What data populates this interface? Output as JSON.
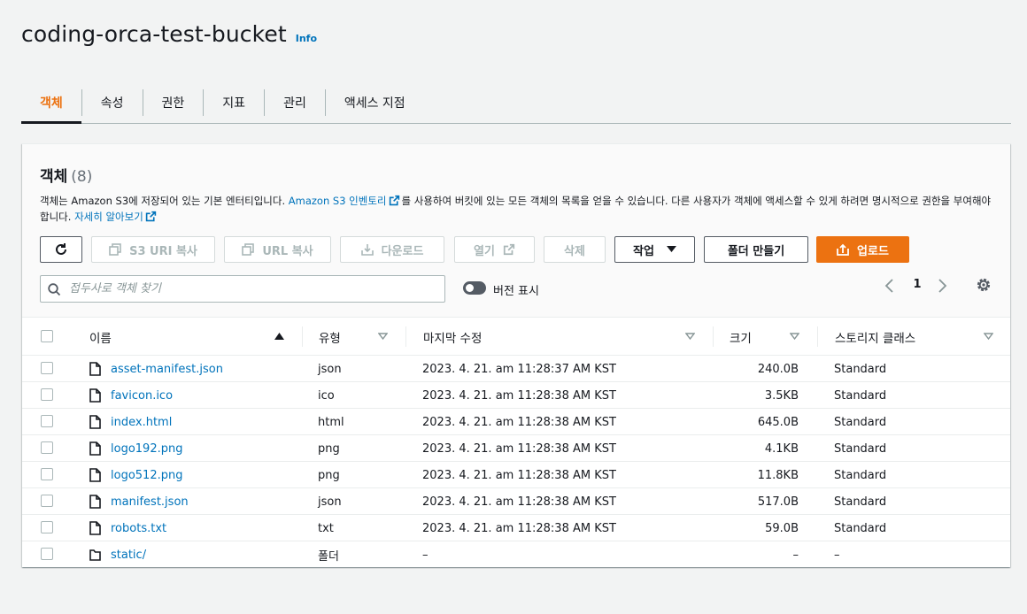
{
  "bucket": {
    "name": "coding-orca-test-bucket",
    "info_label": "Info"
  },
  "tabs": [
    {
      "label": "객체"
    },
    {
      "label": "속성"
    },
    {
      "label": "권한"
    },
    {
      "label": "지표"
    },
    {
      "label": "관리"
    },
    {
      "label": "액세스 지점"
    }
  ],
  "panel": {
    "title": "객체",
    "count": "(8)",
    "desc_part1": "객체는 Amazon S3에 저장되어 있는 기본 엔터티입니다. ",
    "desc_link1": "Amazon S3 인벤토리",
    "desc_part2": "를 사용하여 버킷에 있는 모든 객체의 목록을 얻을 수 있습니다. 다른 사용자가 객체에 액세스할 수 있게 하려면 명시적으로 권한을 부여해야 합니다. ",
    "desc_link2": "자세히 알아보기"
  },
  "toolbar": {
    "copy_s3_uri": "S3 URI 복사",
    "copy_url": "URL 복사",
    "download": "다운로드",
    "open": "열기",
    "delete": "삭제",
    "actions": "작업",
    "create_folder": "폴더 만들기",
    "upload": "업로드"
  },
  "search": {
    "placeholder": "접두사로 객체 찾기"
  },
  "versions_toggle": {
    "label": "버전 표시"
  },
  "pagination": {
    "current_page": "1"
  },
  "columns": {
    "name": "이름",
    "type": "유형",
    "modified": "마지막 수정",
    "size": "크기",
    "storage_class": "스토리지 클래스"
  },
  "rows": [
    {
      "name": "asset-manifest.json",
      "type": "json",
      "modified": "2023. 4. 21. am 11:28:37 AM KST",
      "size": "240.0B",
      "storage": "Standard",
      "kind": "file"
    },
    {
      "name": "favicon.ico",
      "type": "ico",
      "modified": "2023. 4. 21. am 11:28:38 AM KST",
      "size": "3.5KB",
      "storage": "Standard",
      "kind": "file"
    },
    {
      "name": "index.html",
      "type": "html",
      "modified": "2023. 4. 21. am 11:28:38 AM KST",
      "size": "645.0B",
      "storage": "Standard",
      "kind": "file"
    },
    {
      "name": "logo192.png",
      "type": "png",
      "modified": "2023. 4. 21. am 11:28:38 AM KST",
      "size": "4.1KB",
      "storage": "Standard",
      "kind": "file"
    },
    {
      "name": "logo512.png",
      "type": "png",
      "modified": "2023. 4. 21. am 11:28:38 AM KST",
      "size": "11.8KB",
      "storage": "Standard",
      "kind": "file"
    },
    {
      "name": "manifest.json",
      "type": "json",
      "modified": "2023. 4. 21. am 11:28:38 AM KST",
      "size": "517.0B",
      "storage": "Standard",
      "kind": "file"
    },
    {
      "name": "robots.txt",
      "type": "txt",
      "modified": "2023. 4. 21. am 11:28:38 AM KST",
      "size": "59.0B",
      "storage": "Standard",
      "kind": "file"
    },
    {
      "name": "static/",
      "type": "폴더",
      "modified": "–",
      "size": "–",
      "storage": "–",
      "kind": "folder"
    }
  ],
  "colors": {
    "accent": "#ec7211",
    "link": "#0073bb",
    "text": "#16191f",
    "border": "#aab7b8"
  }
}
